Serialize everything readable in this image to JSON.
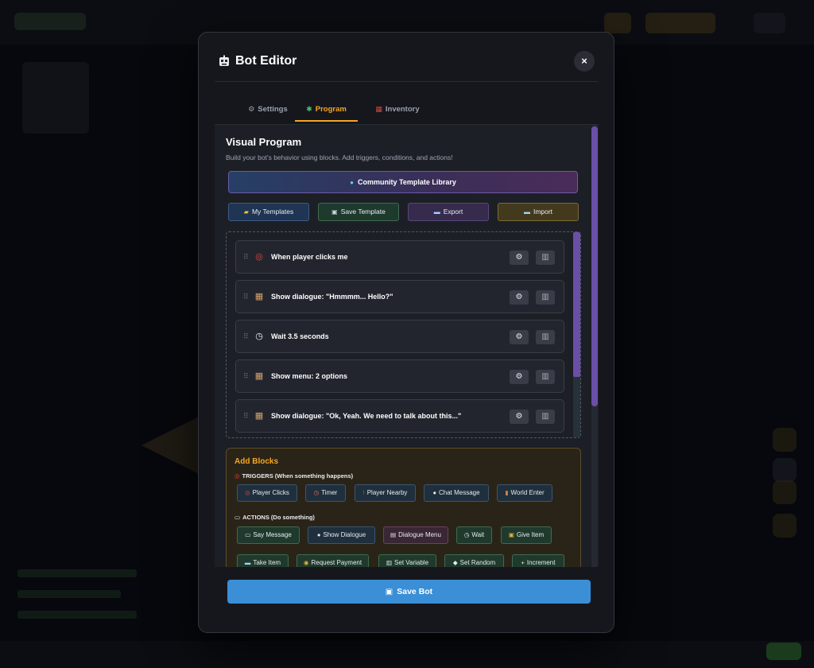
{
  "modal": {
    "title": "Bot Editor",
    "close_label": "×"
  },
  "tabs": [
    {
      "icon": "⚙",
      "label": "Settings"
    },
    {
      "icon": "✱",
      "label": "Program"
    },
    {
      "icon": "▦",
      "label": "Inventory"
    }
  ],
  "program": {
    "title": "Visual Program",
    "subtitle": "Build your bot's behavior using blocks. Add triggers, conditions, and actions!",
    "community_label": "Community Template Library",
    "community_icon": "●",
    "template_buttons": [
      {
        "icon": "▰",
        "label": "My Templates"
      },
      {
        "icon": "▣",
        "label": "Save Template"
      },
      {
        "icon": "▬",
        "label": "Export"
      },
      {
        "icon": "▬",
        "label": "Import"
      }
    ],
    "blocks": [
      {
        "icon": "◎",
        "label": "When player clicks me"
      },
      {
        "icon": "▦",
        "label": "Show dialogue: \"Hmmmm... Hello?\""
      },
      {
        "icon": "◷",
        "label": "Wait 3.5 seconds"
      },
      {
        "icon": "▦",
        "label": "Show menu: 2 options"
      },
      {
        "icon": "▦",
        "label": "Show dialogue: \"Ok, Yeah. We need to talk about this...\""
      }
    ],
    "block_settings_icon": "⚙",
    "block_delete_icon": "▥"
  },
  "add_blocks": {
    "title": "Add Blocks",
    "triggers_heading": "TRIGGERS (When something happens)",
    "triggers_icon": "◎",
    "triggers": [
      {
        "icon": "◎",
        "label": "Player Clicks"
      },
      {
        "icon": "◷",
        "label": "Timer"
      },
      {
        "icon": "!",
        "label": "Player Nearby"
      },
      {
        "icon": "●",
        "label": "Chat Message"
      },
      {
        "icon": "▮",
        "label": "World Enter"
      }
    ],
    "actions_heading": "ACTIONS (Do something)",
    "actions_icon": "▭",
    "actions": [
      {
        "icon": "▭",
        "label": "Say Message"
      },
      {
        "icon": "●",
        "label": "Show Dialogue"
      },
      {
        "icon": "▤",
        "label": "Dialogue Menu"
      },
      {
        "icon": "◷",
        "label": "Wait"
      },
      {
        "icon": "▣",
        "label": "Give Item"
      },
      {
        "icon": "▬",
        "label": "Take Item"
      },
      {
        "icon": "◉",
        "label": "Request Payment"
      },
      {
        "icon": "▥",
        "label": "Set Variable"
      },
      {
        "icon": "◆",
        "label": "Set Random"
      },
      {
        "icon": "+",
        "label": "Increment"
      }
    ]
  },
  "footer": {
    "save_icon": "▣",
    "save_label": "Save Bot"
  }
}
